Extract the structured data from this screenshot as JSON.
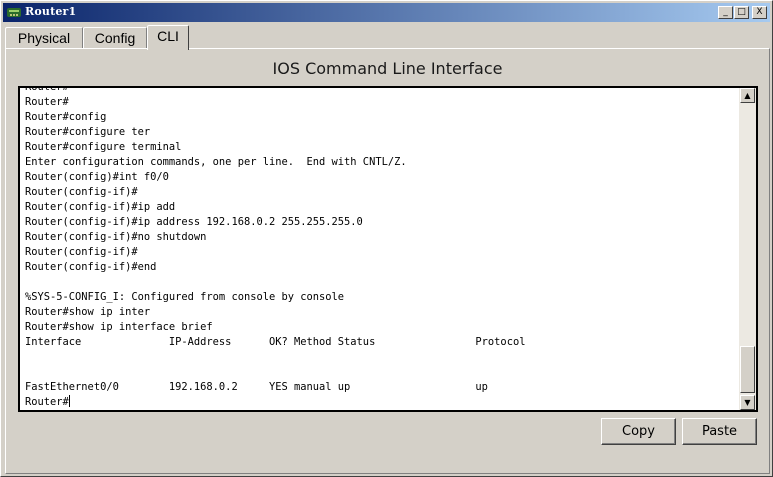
{
  "window": {
    "title": "Router1",
    "controls": {
      "minimize": "_",
      "maximize": "□",
      "close": "X"
    }
  },
  "tabs": [
    {
      "label": "Physical"
    },
    {
      "label": "Config"
    },
    {
      "label": "CLI",
      "active": true
    }
  ],
  "panel": {
    "heading": "IOS Command Line Interface"
  },
  "console": {
    "lines": [
      "Router#",
      "Router#",
      "Router#config",
      "Router#configure ter",
      "Router#configure terminal",
      "Enter configuration commands, one per line.  End with CNTL/Z.",
      "Router(config)#int f0/0",
      "Router(config-if)#",
      "Router(config-if)#ip add",
      "Router(config-if)#ip address 192.168.0.2 255.255.255.0",
      "Router(config-if)#no shutdown",
      "Router(config-if)#",
      "Router(config-if)#end",
      "",
      "%SYS-5-CONFIG_I: Configured from console by console",
      "Router#show ip inter",
      "Router#show ip interface brief",
      "Interface              IP-Address      OK? Method Status                Protocol",
      "",
      "",
      "FastEthernet0/0        192.168.0.2     YES manual up                    up",
      "Router#"
    ]
  },
  "buttons": {
    "copy": "Copy",
    "paste": "Paste"
  },
  "colors": {
    "titlebar_start": "#0a246a",
    "titlebar_end": "#a6caf0",
    "face": "#d4d0c8"
  }
}
